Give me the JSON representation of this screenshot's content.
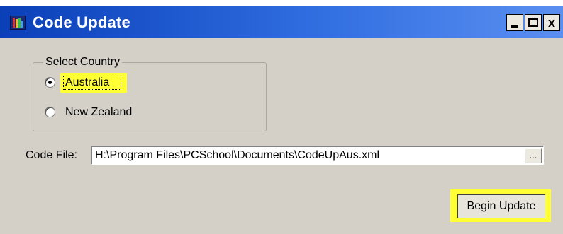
{
  "window": {
    "title": "Code Update",
    "icon": "app-color-bars-icon",
    "buttons": {
      "minimize": "minimize-icon",
      "maximize": "maximize-icon",
      "close_label": "x"
    }
  },
  "country_group": {
    "label": "Select Country",
    "options": [
      {
        "label": "Australia",
        "selected": true,
        "highlighted": true
      },
      {
        "label": "New Zealand",
        "selected": false,
        "highlighted": false
      }
    ]
  },
  "code_file": {
    "label": "Code File:",
    "value": "H:\\Program Files\\PCSchool\\Documents\\CodeUpAus.xml",
    "browse_label": "..."
  },
  "actions": {
    "begin_update_label": "Begin Update"
  },
  "colors": {
    "highlight": "#ffff33",
    "titlebar": "#0a3fb8",
    "dialog_bg": "#d4d0c8"
  }
}
